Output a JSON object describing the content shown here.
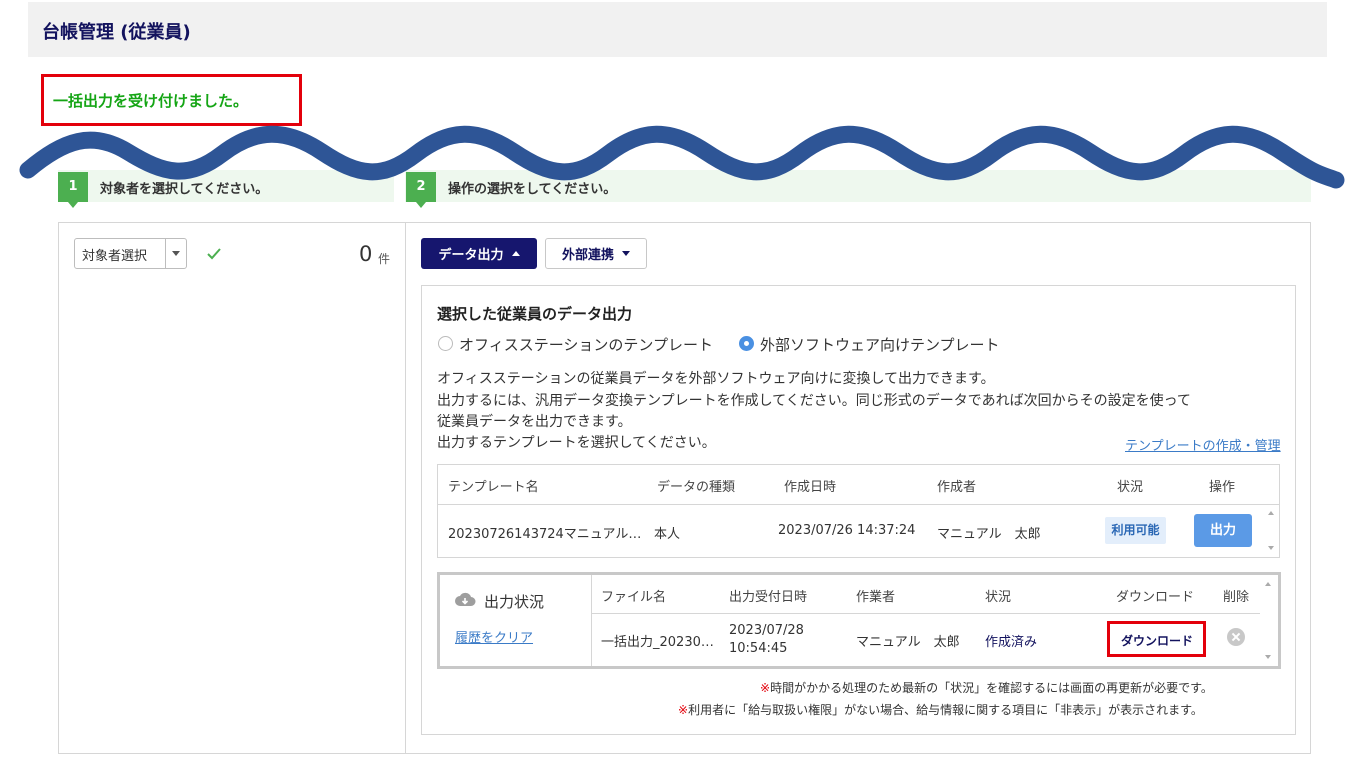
{
  "page": {
    "title": "台帳管理 (従業員)"
  },
  "message": {
    "success": "一括出力を受け付けました。"
  },
  "steps": [
    {
      "number": "1",
      "text": "対象者を選択してください。"
    },
    {
      "number": "2",
      "text": "操作の選択をしてください。"
    }
  ],
  "left": {
    "select_label": "対象者選択",
    "count": "0",
    "count_unit": "件"
  },
  "toolbar": {
    "data_output": "データ出力",
    "external": "外部連携"
  },
  "export": {
    "title": "選択した従業員のデータ出力",
    "radio_office": "オフィスステーションのテンプレート",
    "radio_external": "外部ソフトウェア向けテンプレート",
    "desc1": "オフィスステーションの従業員データを外部ソフトウェア向けに変換して出力できます。",
    "desc2": "出力するには、汎用データ変換テンプレートを作成してください。同じ形式のデータであれば次回からその設定を使って",
    "desc3": "従業員データを出力できます。",
    "desc4": "出力するテンプレートを選択してください。",
    "manage_link": "テンプレートの作成・管理"
  },
  "template_table": {
    "headers": [
      "テンプレート名",
      "データの種類",
      "作成日時",
      "作成者",
      "状況",
      "操作"
    ],
    "rows": [
      {
        "name": "20230726143724マニュアル…",
        "type": "本人",
        "created": "2023/07/26 14:37:24",
        "author": "マニュアル　太郎",
        "status": "利用可能",
        "action": "出力"
      }
    ]
  },
  "output_status": {
    "title": "出力状況",
    "clear_link": "履歴をクリア",
    "headers": [
      "ファイル名",
      "出力受付日時",
      "作業者",
      "状況",
      "ダウンロード",
      "削除"
    ],
    "rows": [
      {
        "file": "一括出力_20230…",
        "date": "2023/07/28",
        "time": "10:54:45",
        "worker": "マニュアル　太郎",
        "status": "作成済み",
        "download": "ダウンロード"
      }
    ]
  },
  "notes": {
    "mark": "※",
    "note1": "時間がかかる処理のため最新の「状況」を確認するには画面の再更新が必要です。",
    "note2": "利用者に「給与取扱い権限」がない場合、給与情報に関する項目に「非表示」が表示されます。"
  },
  "colors": {
    "brand_navy": "#13135e",
    "success_green": "#15a515",
    "highlight_red": "#e3000b",
    "step_green": "#4caf50",
    "button_blue": "#5b9ae6",
    "wave_blue": "#2e5596"
  },
  "icons": [
    "check-icon",
    "cloud-download-icon",
    "delete-icon",
    "chevron-down-icon",
    "chevron-up-icon"
  ]
}
